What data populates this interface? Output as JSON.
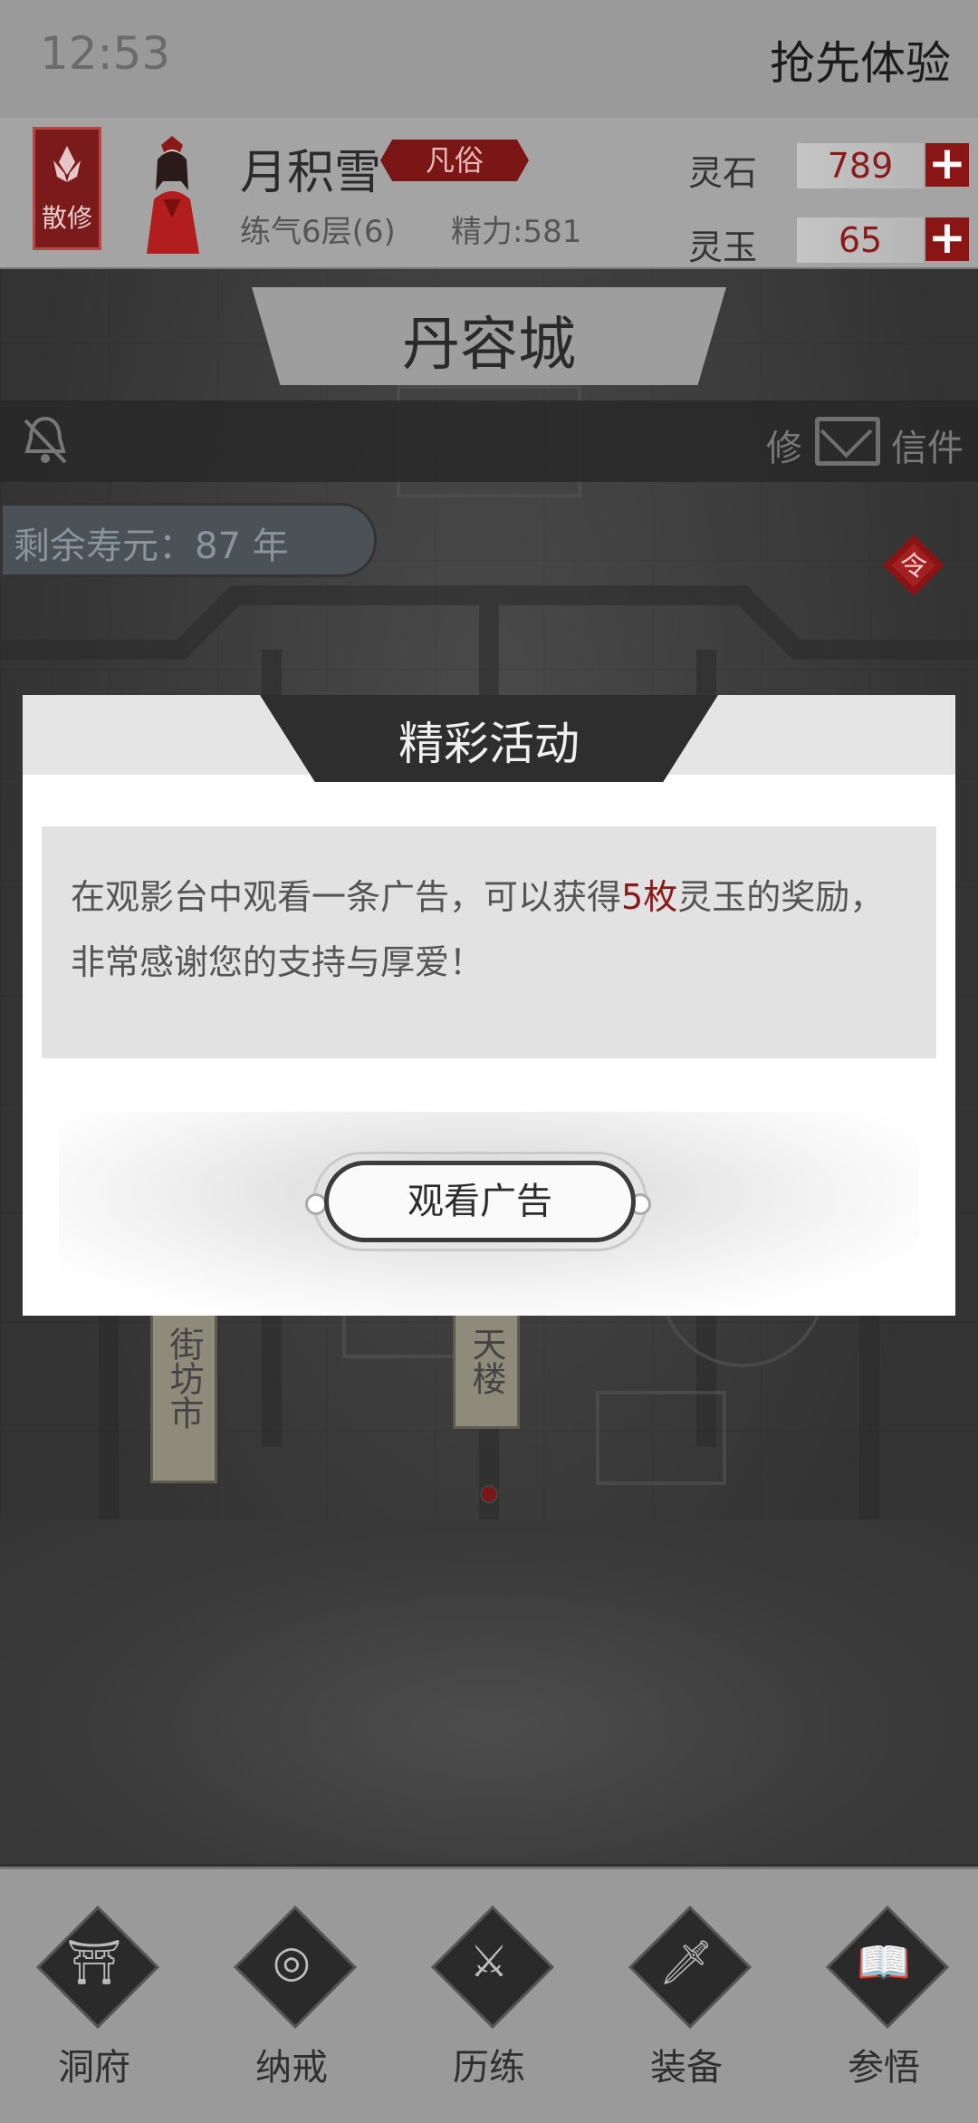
{
  "status_bar": {
    "time": "12:53",
    "right_text": "抢先体验"
  },
  "player": {
    "sect": "散修",
    "name": "月积雪",
    "rank": "凡俗",
    "level": "练气6层(6)",
    "energy": "精力:581"
  },
  "resources": [
    {
      "label": "灵石",
      "value": "789"
    },
    {
      "label": "灵玉",
      "value": "65"
    }
  ],
  "map": {
    "city_name": "丹容城",
    "mail_partial": "修",
    "mail_label": "信件",
    "lifespan": "剩余寿元：87 年",
    "ling_badge": "令",
    "signs": [
      "街坊市",
      "天楼"
    ]
  },
  "modal": {
    "title": "精彩活动",
    "message_before": "在观影台中观看一条广告，可以获得",
    "message_highlight": "5枚",
    "message_after": "灵玉的奖励，非常感谢您的支持与厚爱！",
    "button_label": "观看广告"
  },
  "bottom_nav": [
    {
      "label": "洞府",
      "icon": "cave-icon"
    },
    {
      "label": "纳戒",
      "icon": "ring-icon"
    },
    {
      "label": "历练",
      "icon": "swords-icon"
    },
    {
      "label": "装备",
      "icon": "dagger-icon"
    },
    {
      "label": "参悟",
      "icon": "book-icon"
    }
  ],
  "colors": {
    "accent_red": "#8b1a1a",
    "dark": "#2e2e2e"
  }
}
